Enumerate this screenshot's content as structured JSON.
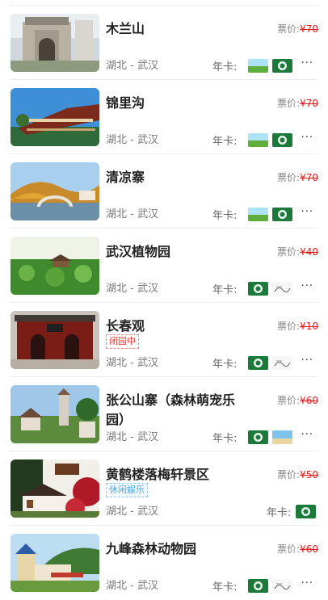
{
  "list": {
    "price_prefix": "票价:",
    "card_label": "年卡:",
    "more": "···",
    "items": [
      {
        "name": "木兰山",
        "location": "湖北 - 武汉",
        "price": "¥70",
        "tag": "",
        "cards": [
          "green-landscape-card",
          "green-circle-card"
        ]
      },
      {
        "name": "锦里沟",
        "location": "湖北 - 武汉",
        "price": "¥70",
        "tag": "",
        "cards": [
          "green-landscape-card",
          "green-circle-card"
        ]
      },
      {
        "name": "清凉寨",
        "location": "湖北 - 武汉",
        "price": "¥70",
        "tag": "",
        "cards": [
          "green-landscape-card",
          "green-circle-card"
        ]
      },
      {
        "name": "武汉植物园",
        "location": "湖北 - 武汉",
        "price": "¥40",
        "tag": "",
        "cards": [
          "green-circle-card",
          "white-sketch-card"
        ]
      },
      {
        "name": "长春观",
        "location": "湖北 - 武汉",
        "price": "¥10",
        "tag": "闭园中",
        "cards": [
          "green-circle-card",
          "white-sketch-card"
        ]
      },
      {
        "name": "张公山寨（森林萌宠乐园）",
        "location": "湖北 - 武汉",
        "price": "¥60",
        "tag": "",
        "cards": [
          "green-circle-card",
          "blue-landscape-card"
        ]
      },
      {
        "name": "黄鹤楼落梅轩景区",
        "location": "湖北 - 武汉",
        "price": "¥50",
        "tag": "休闲娱乐",
        "cards": [
          "green-circle-card"
        ]
      },
      {
        "name": "九峰森林动物园",
        "location": "湖北 - 武汉",
        "price": "¥60",
        "tag": "",
        "cards": [
          "green-circle-card",
          "white-sketch-card"
        ]
      }
    ]
  }
}
